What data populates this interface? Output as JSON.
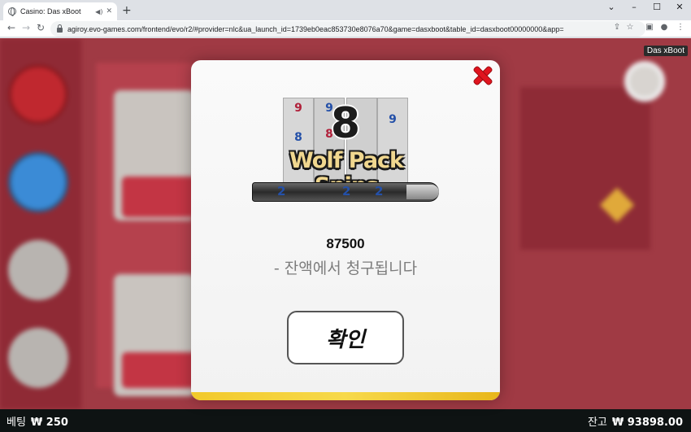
{
  "browser": {
    "tab_title": "Casino: Das xBoot",
    "tab_audio_icon": "speaker-icon",
    "tab_close": "✕",
    "new_tab": "+",
    "window_controls": [
      "⌄",
      "–",
      "☐",
      "✕"
    ],
    "url": "agiroy.evo-games.com/frontend/evo/r2/#provider=nlc&ua_launch_id=1739eb0eac853730e8076a70&game=dasxboot&table_id=dasxboot00000000&app=",
    "nav": {
      "back": "←",
      "forward": "→",
      "reload": "↻"
    },
    "toolbar_icons": [
      "share-icon",
      "star-icon",
      "sidepanel-icon",
      "profile-icon",
      "menu-icon"
    ]
  },
  "game": {
    "badge": "Das xBoot",
    "bottom": {
      "bet_label": "베팅",
      "bet_value": "₩ 250",
      "balance_label": "잔고",
      "balance_value": "₩ 93898.00"
    }
  },
  "modal": {
    "logo": {
      "number": "8",
      "title": "Wolf Pack Spins",
      "reel_digits": [
        "9",
        "8",
        "8",
        "9",
        "9",
        "9"
      ],
      "bullet_digits": [
        "2",
        "2",
        "2"
      ]
    },
    "amount": "87500",
    "note": "- 잔액에서 청구됩니다",
    "confirm_label": "확인"
  },
  "colors": {
    "game_bg": "#a03a44",
    "close_red": "#e0141e",
    "gold": "#f2c92b"
  }
}
